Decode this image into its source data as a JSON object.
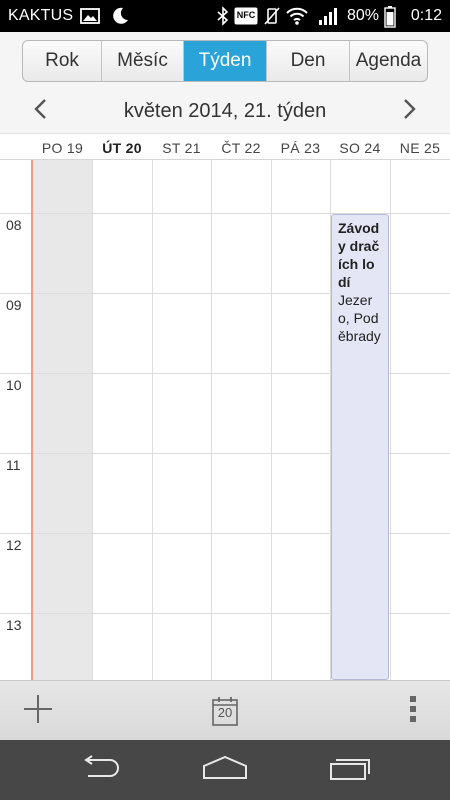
{
  "status_bar": {
    "carrier": "KAKTUS",
    "battery_percent": "80%",
    "time": "0:12",
    "icons": [
      "image-icon",
      "moon-icon",
      "bluetooth-icon",
      "nfc-icon",
      "vibrate-mute-icon",
      "wifi-icon",
      "signal-icon",
      "battery-icon"
    ],
    "nfc_label": "NFC"
  },
  "tabs": [
    {
      "label": "Rok",
      "active": false
    },
    {
      "label": "Měsíc",
      "active": false
    },
    {
      "label": "Týden",
      "active": true
    },
    {
      "label": "Den",
      "active": false
    },
    {
      "label": "Agenda",
      "active": false
    }
  ],
  "week_header": {
    "title": "květen 2014, 21. týden",
    "prev_icon": "chevron-left-icon",
    "next_icon": "chevron-right-icon"
  },
  "days": [
    {
      "label": "PO 19",
      "today": false
    },
    {
      "label": "ÚT 20",
      "today": true
    },
    {
      "label": "ST 21",
      "today": false
    },
    {
      "label": "ČT 22",
      "today": false
    },
    {
      "label": "PÁ 23",
      "today": false
    },
    {
      "label": "SO 24",
      "today": false
    },
    {
      "label": "NE 25",
      "today": false
    }
  ],
  "hours": [
    "08",
    "09",
    "10",
    "11",
    "12",
    "13"
  ],
  "event": {
    "title": "Závody dračích lodí",
    "location": "Jezero, Poděbrady",
    "day": "SO 24",
    "start_hour": "08"
  },
  "action_bar": {
    "add_icon": "plus-icon",
    "today_icon": "calendar-today-icon",
    "today_number": "20",
    "more_icon": "overflow-menu-icon"
  },
  "nav_bar": {
    "icons": [
      "back-icon",
      "home-icon",
      "recent-apps-icon"
    ]
  },
  "colors": {
    "accent": "#2aa3d8",
    "event_bg": "#e4e6f6",
    "today_line": "#f29a85"
  }
}
